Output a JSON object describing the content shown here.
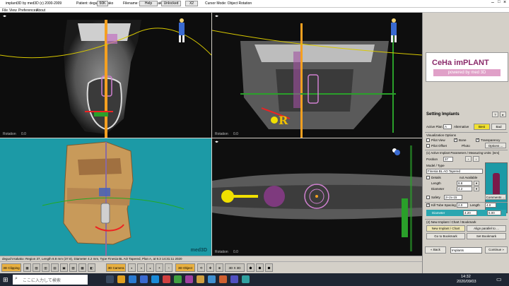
{
  "titlebar": {
    "app_title": "implant3D by med3D (c) 2000-2009",
    "patient": "Patient: deguchi-takako",
    "filename": "Filename: deguchi-takako",
    "zoom": "50K",
    "help": "Help",
    "unlocked": "Unlocked",
    "x2": "X2",
    "cursor_mode": "Cursor Mode: Object Rotation"
  },
  "menu": [
    "File",
    "View",
    "Preferences",
    "About"
  ],
  "views": {
    "rotation_label": "Rotation",
    "rotation_value": "0.0",
    "letter_r": "R",
    "med3d_mark": "med3D"
  },
  "panel": {
    "logo_top": "CeHa imPLANT",
    "logo_bottom": "powered by med 3D",
    "section_title": "Setting Implants",
    "help_btn": "?",
    "active_plan_label": "Active Plan:",
    "active_plan_value": "A",
    "alternative_label": "Alternative",
    "best_btn": "Best",
    "bad_btn": "Bad",
    "vis_options_title": "Visualization Options",
    "pilot_view": "Pilot View",
    "bone": "Bone",
    "transparency": "Transparency",
    "pilot_offset": "Pilot Offset",
    "photo": "Photo",
    "options_btn": "Options ...",
    "params_title": "(1) Active Implant Parameters / Measuring Units: [mm]",
    "position_label": "Position",
    "position_value": "37",
    "model_type_label": "Model / Type",
    "model_value": "Finesia BL AO Tapered",
    "details_label": "Details",
    "not_available": "not Available",
    "length_label": "Length",
    "length_value": "8.8",
    "diameter_label": "Diameter",
    "diameter_value": "4.2",
    "safety_label": "Safety",
    "safety_value": "2+2x-15",
    "comments_btn": "Comments ...",
    "kill_tube_label": "Kill Tube Spacing",
    "kill_tube_value": "2.0",
    "length2_label": "Length",
    "length2_value": "4.0",
    "diameter2_label": "Diameter",
    "diameter2_value": "4.20",
    "diameter2_extra": "5.00",
    "new_implant_title": "(2) New Implant / Chart / Bookmark",
    "new_implant_btn": "New Implant / Chart",
    "align_btn": "Align parallel to ...",
    "goto_bookmark_btn": "Go to Bookmark",
    "set_bookmark_btn": "Set Bookmark",
    "back_btn": "Back",
    "implants_select": "Implants",
    "continue_btn": "Continue"
  },
  "status": {
    "text": "deguchi-takako: Region 37, Length 8.8 mm (37.8), Diameter 4.2 mm, Type Finesia BL AO Tapered, Plan A, at 9.3 14:31:11 2020"
  },
  "toolbar": {
    "items": [
      "3D Clipping",
      "3D Camera",
      "3D Object",
      "3D X 3D"
    ]
  },
  "taskbar": {
    "search_placeholder": "ここに入力して検索",
    "time": "14:32",
    "date": "2020/09/03"
  }
}
